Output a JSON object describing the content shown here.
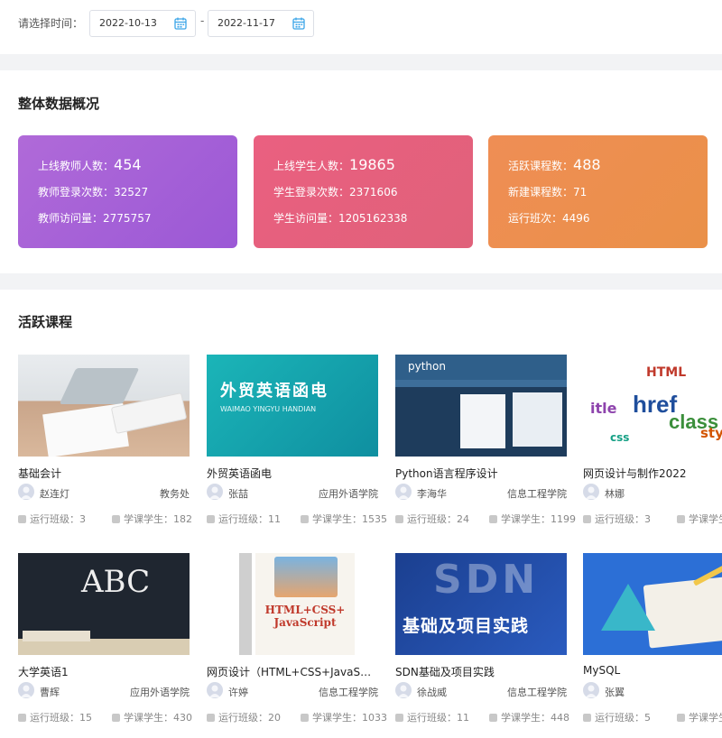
{
  "filter": {
    "label": "请选择时间：",
    "start_date": "2022-10-13",
    "separator": "-",
    "end_date": "2022-11-17"
  },
  "overview": {
    "title": "整体数据概况",
    "cards": [
      {
        "color_from": "#b06ad8",
        "color_to": "#9b58d6",
        "rows": [
          {
            "label": "上线教师人数：",
            "value": "454"
          },
          {
            "label": "教师登录次数：",
            "value": "32527"
          },
          {
            "label": "教师访问量：",
            "value": "2775757"
          }
        ]
      },
      {
        "color_from": "#ea6080",
        "color_to": "#e0617a",
        "rows": [
          {
            "label": "上线学生人数：",
            "value": "19865"
          },
          {
            "label": "学生登录次数：",
            "value": "2371606"
          },
          {
            "label": "学生访问量：",
            "value": "1205162338"
          }
        ]
      },
      {
        "color_from": "#ef8e55",
        "color_to": "#ea9048",
        "rows": [
          {
            "label": "活跃课程数：",
            "value": "488"
          },
          {
            "label": "新建课程数：",
            "value": "71"
          },
          {
            "label": "运行班次：",
            "value": "4496"
          }
        ]
      }
    ]
  },
  "active": {
    "title": "活跃课程",
    "courses": [
      {
        "title": "基础会计",
        "teacher": "赵连灯",
        "dept": "教务处",
        "classes_label": "运行班级：3",
        "students_label": "学课学生：182",
        "thumb": "desk"
      },
      {
        "title": "外贸英语函电",
        "teacher": "张喆",
        "dept": "应用外语学院",
        "classes_label": "运行班级：11",
        "students_label": "学课学生：1535",
        "thumb": "book-teal",
        "thumb_text": "外贸英语函电",
        "thumb_sub": "WAIMAO YINGYU HANDIAN"
      },
      {
        "title": "Python语言程序设计",
        "teacher": "李海华",
        "dept": "信息工程学院",
        "classes_label": "运行班级：24",
        "students_label": "学课学生：1199",
        "thumb": "python",
        "thumb_text": "python"
      },
      {
        "title": "网页设计与制作2022",
        "teacher": "林娜",
        "dept": "信息工",
        "classes_label": "运行班级：3",
        "students_label": "学课学生",
        "thumb": "wordcloud"
      },
      {
        "title": "大学英语1",
        "teacher": "曹辉",
        "dept": "应用外语学院",
        "classes_label": "运行班级：15",
        "students_label": "学课学生：430",
        "thumb": "chalk",
        "thumb_text": "ABC"
      },
      {
        "title": "网页设计（HTML+CSS+JavaS…",
        "teacher": "许婷",
        "dept": "信息工程学院",
        "classes_label": "运行班级：20",
        "students_label": "学课学生：1033",
        "thumb": "htmlbook",
        "thumb_text": "HTML+CSS+ JavaScript"
      },
      {
        "title": "SDN基础及项目实践",
        "teacher": "徐战威",
        "dept": "信息工程学院",
        "classes_label": "运行班级：11",
        "students_label": "学课学生：448",
        "thumb": "sdn",
        "thumb_text": "SDN",
        "thumb_sub": "基础及项目实践"
      },
      {
        "title": "MySQL",
        "teacher": "张翼",
        "dept": "信息工",
        "classes_label": "运行班级：5",
        "students_label": "学课学生",
        "thumb": "mysql"
      }
    ]
  }
}
